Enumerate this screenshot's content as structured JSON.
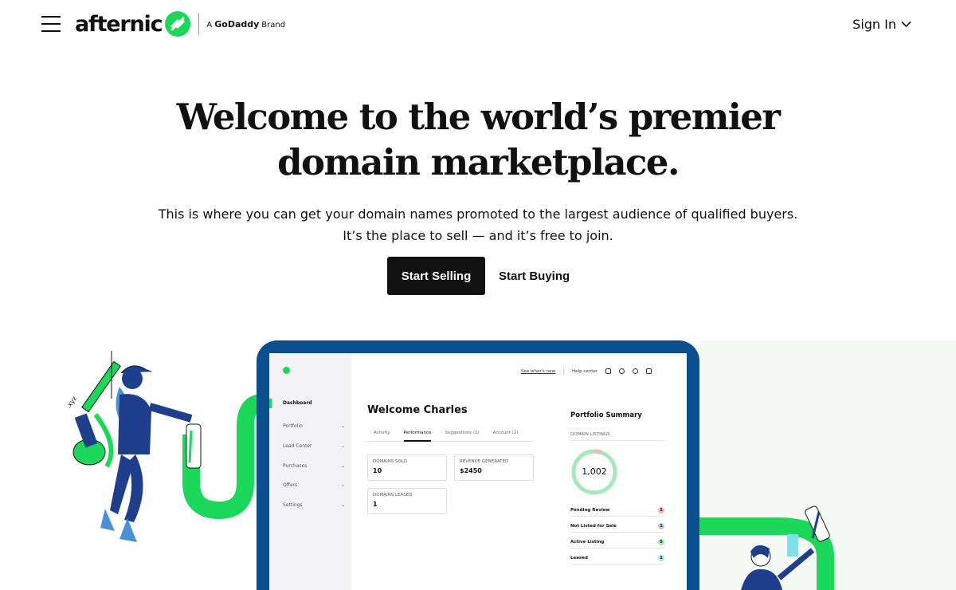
{
  "header": {
    "logo_word": "afternic",
    "brand_prefix": "A",
    "brand_name": "GoDaddy",
    "brand_suffix": "Brand",
    "signin_label": "Sign In"
  },
  "hero": {
    "title_line1": "Welcome to the world’s premier",
    "title_line2": "domain marketplace.",
    "sub_line1": "This is where you can get your domain names promoted to the largest audience of qualified buyers.",
    "sub_line2": "It’s the place to sell — and it’s free to join.",
    "primary_cta": "Start Selling",
    "secondary_cta": "Start Buying"
  },
  "dashboard": {
    "topbar": {
      "whats_new": "See what's new",
      "help": "Help center"
    },
    "sidebar": [
      {
        "label": "Dashboard",
        "active": true,
        "chevron": false
      },
      {
        "label": "Portfolio",
        "active": false,
        "chevron": true
      },
      {
        "label": "Lead Center",
        "active": false,
        "chevron": true
      },
      {
        "label": "Purchases",
        "active": false,
        "chevron": true
      },
      {
        "label": "Offers",
        "active": false,
        "chevron": true
      },
      {
        "label": "Settings",
        "active": false,
        "chevron": true
      }
    ],
    "welcome": "Welcome Charles",
    "tabs": [
      "Activity",
      "Performance",
      "Suggestions (1)",
      "Account (2)"
    ],
    "active_tab": "Performance",
    "cards": [
      {
        "label": "Domains Sold",
        "value": "10"
      },
      {
        "label": "Revenue Generated",
        "value": "$2450"
      },
      {
        "label": "Domains Leased",
        "value": "1"
      }
    ],
    "portfolio": {
      "title": "Portfolio Summary",
      "listings_label": "DOMAIN LISTINGS",
      "total": "1,002",
      "statuses": [
        {
          "label": "Pending Review",
          "count": "1",
          "color": "#f5b7b1"
        },
        {
          "label": "Not Listed for Sale",
          "count": "1",
          "color": "#c9c3f0"
        },
        {
          "label": "Active Listing",
          "count": "5",
          "color": "#a6e9b8"
        },
        {
          "label": "Leased",
          "count": "1",
          "color": "#a8e4f0"
        }
      ]
    }
  },
  "colors": {
    "accent_green": "#1bd85a",
    "device_blue": "#0b4f8e",
    "text_dark": "#111111",
    "illustration_navy": "#1f3f8c"
  }
}
